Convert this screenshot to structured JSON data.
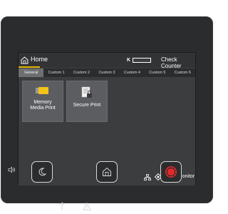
{
  "header": {
    "title": "Home",
    "toner_label": "K",
    "check_counter": "Check Counter"
  },
  "tabs": [
    "General",
    "Custom 1",
    "Custom 2",
    "Custom 3",
    "Custom 4",
    "Custom 5",
    "Custom 6"
  ],
  "active_tab": "General",
  "tiles": [
    {
      "line1": "Memory",
      "line2": "Media Print",
      "icon": "usb-memory-icon"
    },
    {
      "line1": "Secure Print",
      "line2": "",
      "icon": "secure-print-icon"
    }
  ],
  "footer": {
    "status_monitor": "Status Monitor"
  },
  "colors": {
    "accent": "#e8b400",
    "stop_button": "#e02a2a",
    "usb_icon": "#f3c318"
  }
}
